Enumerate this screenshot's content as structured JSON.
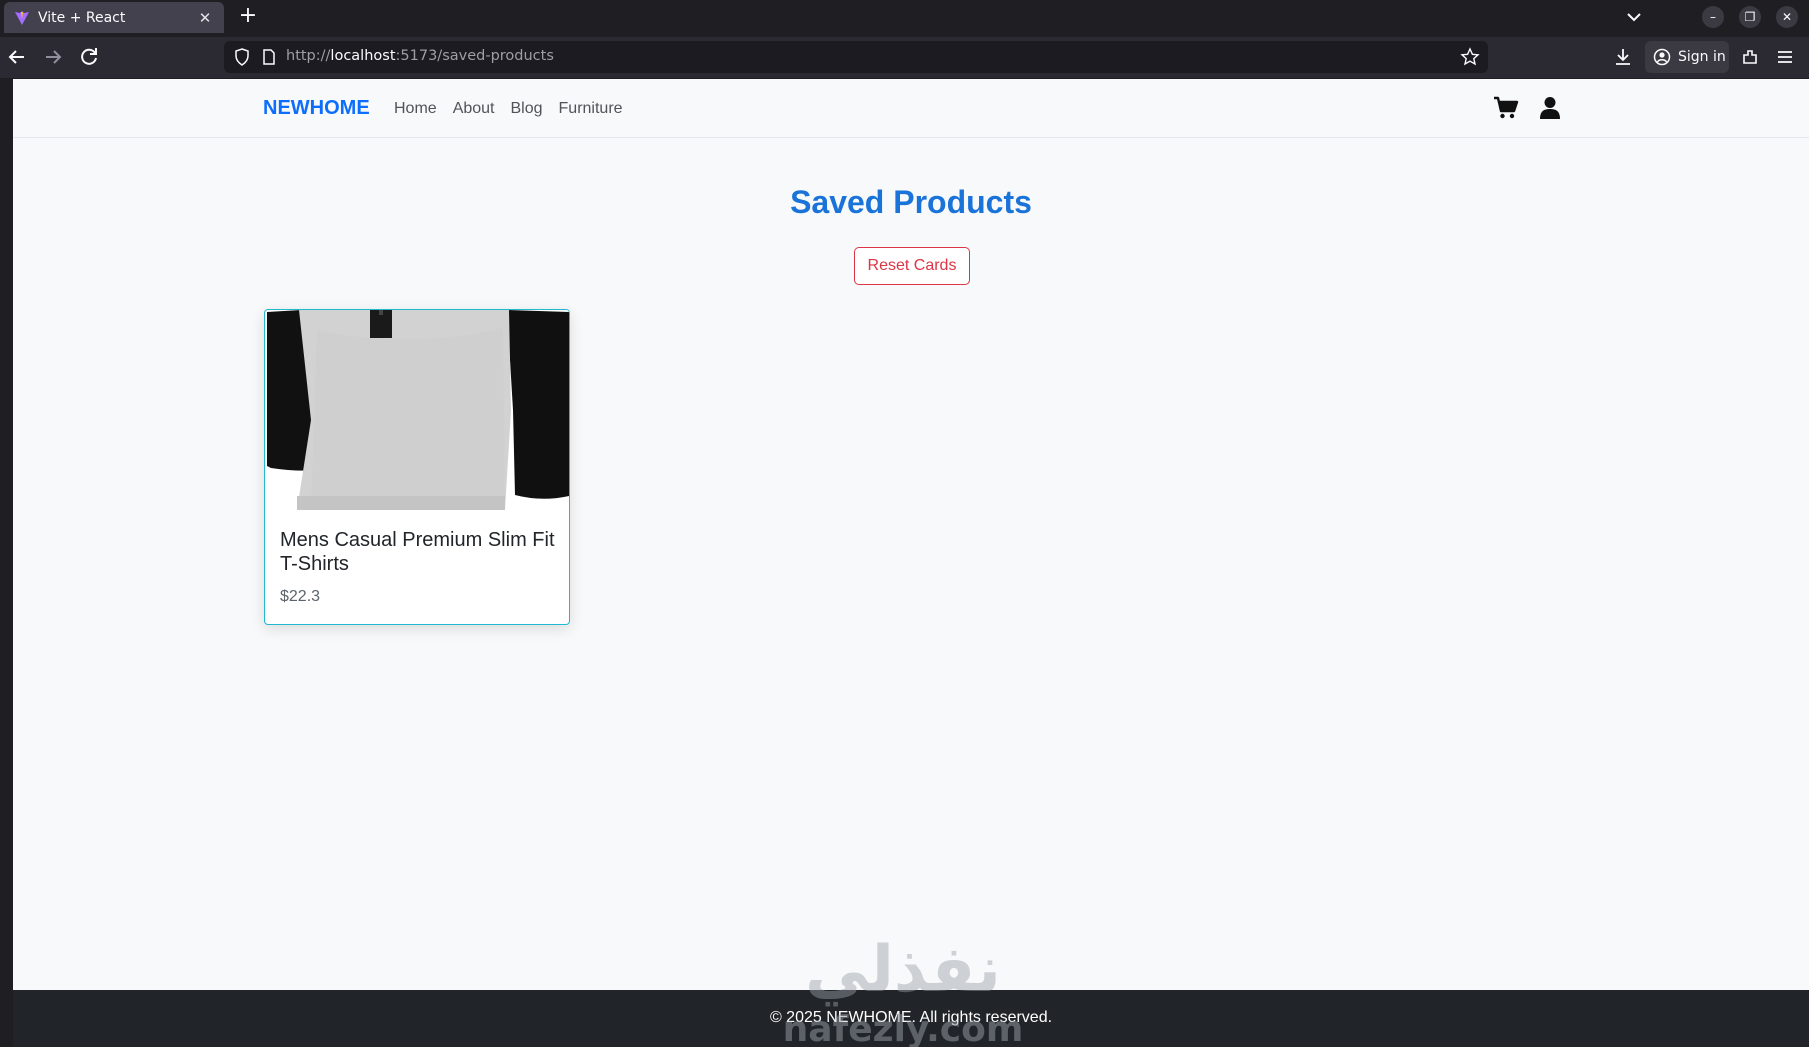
{
  "browser": {
    "tab_title": "Vite + React",
    "url_prefix": "http://",
    "url_host": "localhost",
    "url_rest": ":5173/saved-products",
    "signin_label": "Sign in"
  },
  "site": {
    "brand": "NEWHOME",
    "nav": [
      "Home",
      "About",
      "Blog",
      "Furniture"
    ]
  },
  "page": {
    "title": "Saved Products",
    "reset_label": "Reset Cards"
  },
  "products": [
    {
      "title": "Mens Casual Premium Slim Fit T-Shirts",
      "price": "$22.3"
    }
  ],
  "footer": {
    "text": "© 2025 NEWHOME. All rights reserved."
  },
  "watermark": {
    "arabic": "نفذلي",
    "latin": "nafezly.com"
  },
  "colors": {
    "brand": "#0d6efd",
    "heading": "#1a73d9",
    "danger": "#dc3545",
    "card_border": "#22b8cf",
    "footer_bg": "#212529"
  }
}
